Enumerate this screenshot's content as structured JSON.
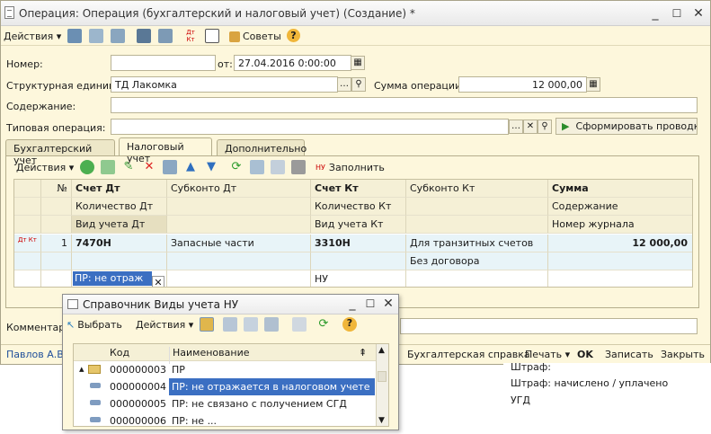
{
  "window": {
    "title": "Операция: Операция (бухгалтерский и налоговый учет) (Создание) *",
    "min": "_",
    "max": "☐",
    "close": "✕"
  },
  "toolbar": {
    "actions": "Действия",
    "tips": "Советы",
    "help": "?"
  },
  "form": {
    "number_label": "Номер:",
    "number_value": "",
    "from_label": "от:",
    "date_value": "27.04.2016  0:00:00",
    "unit_label": "Структурная единица:",
    "unit_value": "ТД Лакомка",
    "sum_label": "Сумма операции:",
    "sum_value": "12 000,00",
    "content_label": "Содержание:",
    "content_value": "",
    "typical_label": "Типовая операция:",
    "typical_value": "",
    "generate_button": "Сформировать проводки",
    "comment_label": "Комментари"
  },
  "tabs": [
    "Бухгалтерский учет",
    "Налоговый учет",
    "Дополнительно"
  ],
  "active_tab": 1,
  "grid_toolbar": {
    "actions": "Действия",
    "fill": "Заполнить"
  },
  "grid": {
    "headers": {
      "r1": [
        "№",
        "Счет Дт",
        "Субконто Дт",
        "Счет Кт",
        "Субконто Кт",
        "Сумма"
      ],
      "r2": [
        "Количество Дт",
        "Количество Кт",
        "Содержание"
      ],
      "r3": [
        "Вид учета Дт",
        "Вид учета Кт",
        "Номер журнала"
      ]
    },
    "row": {
      "n": "1",
      "acc_dt": "7470Н",
      "sub_dt": "Запасные части",
      "acc_kt": "3310Н",
      "sub_kt": "Для транзитных счетов",
      "sum": "12 000,00",
      "sub_kt2": "Без договора",
      "vid_dt": "ПР: не отраж",
      "vid_kt": "НУ"
    },
    "row_icon": "Дт Кт"
  },
  "footer": {
    "user": "Павлов А.В.",
    "spravka": "Бухгалтерская справка",
    "print": "Печать",
    "ok": "OK",
    "save": "Записать",
    "close": "Закрыть"
  },
  "background_list": [
    "Штраф:",
    "Штраф: начислено / уплачено",
    "УГД"
  ],
  "dialog": {
    "title": "Справочник Виды учета НУ",
    "select": "Выбрать",
    "actions": "Действия",
    "help": "?",
    "col_code": "Код",
    "col_name": "Наименование",
    "rows": [
      {
        "code": "000000003",
        "name": "ПР",
        "type": "folder"
      },
      {
        "code": "000000004",
        "name": "ПР: не отражается в налоговом учете",
        "type": "item",
        "selected": true
      },
      {
        "code": "000000005",
        "name": "ПР: не связано с получением СГД",
        "type": "item"
      },
      {
        "code": "000000006",
        "name": "ПР: не ...",
        "type": "item"
      }
    ]
  }
}
